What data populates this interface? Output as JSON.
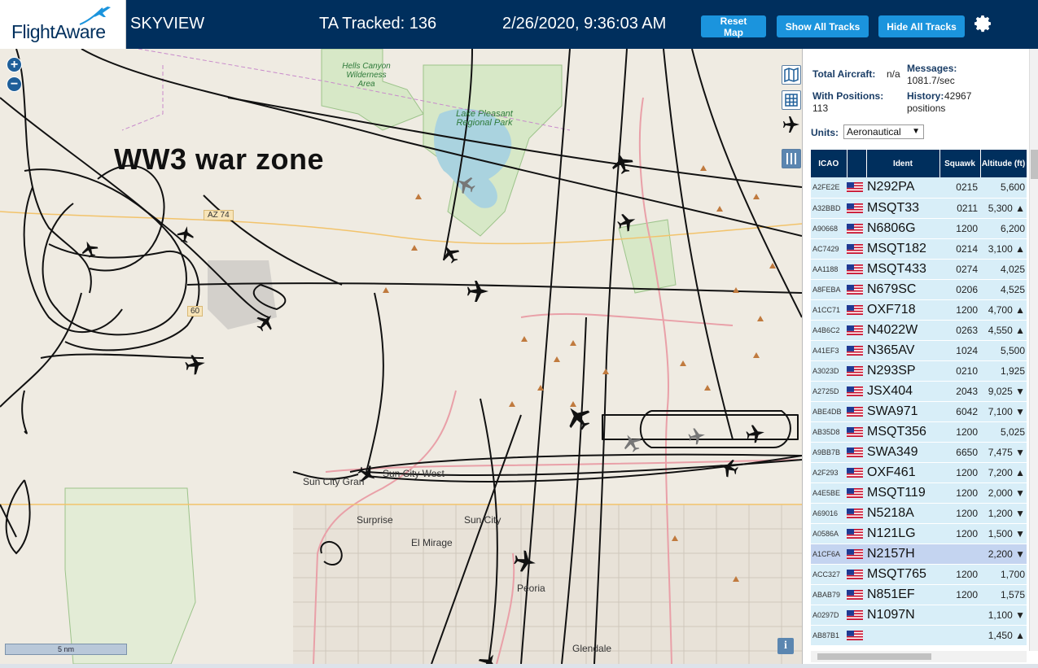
{
  "header": {
    "logo_text": "FlightAware",
    "app_title": "SKYVIEW",
    "tracked_label": "TA Tracked: 136",
    "datetime": "2/26/2020, 9:36:03 AM",
    "reset_map": "Reset Map",
    "show_all_tracks": "Show All Tracks",
    "hide_all_tracks": "Hide All Tracks"
  },
  "map": {
    "annotation": "WW3 war zone",
    "zoom_in": "+",
    "zoom_out": "−",
    "scale_label": "5 nm",
    "info": "i",
    "labels": {
      "sun_city_west": "Sun City West",
      "sun_city_grand": "Sun City Gran",
      "surprise": "Surprise",
      "sun_city": "Sun City",
      "el_mirage": "El Mirage",
      "peoria": "Peoria",
      "glendale": "Glendale",
      "az74": "AZ 74",
      "route_80": "60",
      "hells_canyon": "Hells Canyon Wilderness Area",
      "lake_pleasant": "Lake Pleasant Regional Park"
    }
  },
  "stats": {
    "total_label": "Total Aircraft:",
    "total_value": "n/a",
    "messages_label": "Messages:",
    "messages_value": "1081.7/sec",
    "positions_label": "With Positions:",
    "positions_value": "113",
    "history_label": "History:",
    "history_value": "42967 positions"
  },
  "units": {
    "label": "Units:",
    "selected": "Aeronautical"
  },
  "table": {
    "headers": {
      "icao": "ICAO",
      "ident": "Ident",
      "squawk": "Squawk",
      "altitude": "Altitude (ft)"
    },
    "rows": [
      {
        "icao": "A2FE2E",
        "ident": "N292PA",
        "squawk": "0215",
        "alt": "5,600"
      },
      {
        "icao": "A32BBD",
        "ident": "MSQT33",
        "squawk": "0211",
        "alt": "5,300 ▲"
      },
      {
        "icao": "A90668",
        "ident": "N6806G",
        "squawk": "1200",
        "alt": "6,200"
      },
      {
        "icao": "AC7429",
        "ident": "MSQT182",
        "squawk": "0214",
        "alt": "3,100 ▲"
      },
      {
        "icao": "AA1188",
        "ident": "MSQT433",
        "squawk": "0274",
        "alt": "4,025"
      },
      {
        "icao": "A8FEBA",
        "ident": "N679SC",
        "squawk": "0206",
        "alt": "4,525"
      },
      {
        "icao": "A1CC71",
        "ident": "OXF718",
        "squawk": "1200",
        "alt": "4,700 ▲"
      },
      {
        "icao": "A4B6C2",
        "ident": "N4022W",
        "squawk": "0263",
        "alt": "4,550 ▲"
      },
      {
        "icao": "A41EF3",
        "ident": "N365AV",
        "squawk": "1024",
        "alt": "5,500"
      },
      {
        "icao": "A3023D",
        "ident": "N293SP",
        "squawk": "0210",
        "alt": "1,925"
      },
      {
        "icao": "A2725D",
        "ident": "JSX404",
        "squawk": "2043",
        "alt": "9,025 ▼"
      },
      {
        "icao": "ABE4DB",
        "ident": "SWA971",
        "squawk": "6042",
        "alt": "7,100 ▼"
      },
      {
        "icao": "AB35D8",
        "ident": "MSQT356",
        "squawk": "1200",
        "alt": "5,025"
      },
      {
        "icao": "A9BB7B",
        "ident": "SWA349",
        "squawk": "6650",
        "alt": "7,475 ▼"
      },
      {
        "icao": "A2F293",
        "ident": "OXF461",
        "squawk": "1200",
        "alt": "7,200 ▲"
      },
      {
        "icao": "A4E5BE",
        "ident": "MSQT119",
        "squawk": "1200",
        "alt": "2,000 ▼"
      },
      {
        "icao": "A69016",
        "ident": "N5218A",
        "squawk": "1200",
        "alt": "1,200 ▼"
      },
      {
        "icao": "A0586A",
        "ident": "N121LG",
        "squawk": "1200",
        "alt": "1,500 ▼"
      },
      {
        "icao": "A1CF6A",
        "ident": "N2157H",
        "squawk": "",
        "alt": "2,200 ▼",
        "selected": true
      },
      {
        "icao": "ACC327",
        "ident": "MSQT765",
        "squawk": "1200",
        "alt": "1,700"
      },
      {
        "icao": "ABAB79",
        "ident": "N851EF",
        "squawk": "1200",
        "alt": "1,575"
      },
      {
        "icao": "A0297D",
        "ident": "N1097N",
        "squawk": "",
        "alt": "1,100 ▼"
      },
      {
        "icao": "AB87B1",
        "ident": "",
        "squawk": "",
        "alt": "1,450 ▲"
      }
    ]
  },
  "colors": {
    "header_bg": "#002f5d",
    "button": "#1b94dd",
    "map_bg": "#efebe2",
    "row_bg": "#d8eef8",
    "row_selected": "#c4d4f0"
  }
}
